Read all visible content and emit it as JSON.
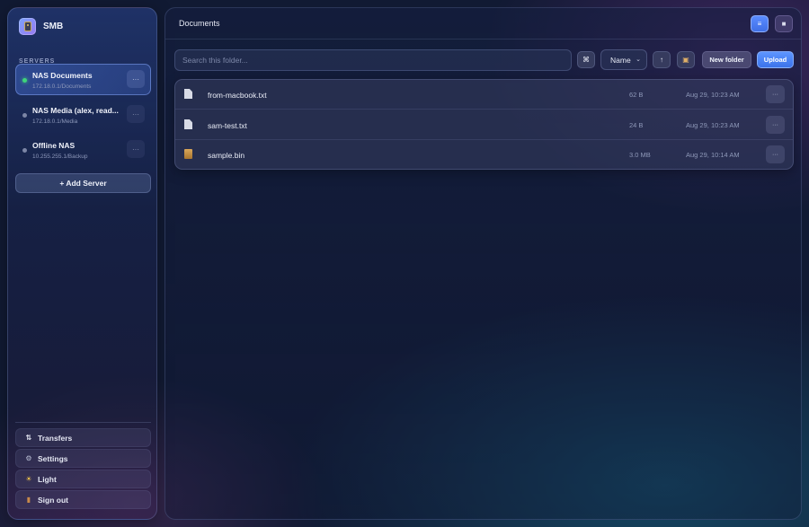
{
  "app": {
    "name": "SMB"
  },
  "sidebar": {
    "section_label": "SERVERS",
    "servers": [
      {
        "name": "NAS Documents",
        "path": "172.18.0.1/Documents",
        "status": "online",
        "more": "···"
      },
      {
        "name": "NAS Media (alex, read...",
        "path": "172.18.0.1/Media",
        "status": "idle",
        "more": "···"
      },
      {
        "name": "Offline NAS",
        "path": "10.255.255.1/Backup",
        "status": "offline",
        "more": "···"
      }
    ],
    "add_server_label": "+ Add Server",
    "footer": [
      {
        "icon": "transfer-icon",
        "glyph": "⇅",
        "label": "Transfers"
      },
      {
        "icon": "gear-icon",
        "glyph": "⚙",
        "label": "Settings"
      },
      {
        "icon": "sun-icon",
        "glyph": "☀",
        "label": "Light"
      },
      {
        "icon": "door-icon",
        "glyph": "▮",
        "label": "Sign out"
      }
    ]
  },
  "main": {
    "title": "Documents",
    "view_list_glyph": "≡",
    "view_grid_glyph": "■",
    "search_placeholder": "Search this folder...",
    "filter_glyph": "⌘",
    "sort_value": "Name",
    "sort_chevron": "⌄",
    "sort_dir_glyph": "↑",
    "archive_glyph": "▣",
    "new_folder_label": "New folder",
    "upload_label": "Upload",
    "files": [
      {
        "icon": "file-icon",
        "name": "from-macbook.txt",
        "size": "62 B",
        "date": "Aug 29, 10:23 AM",
        "more": "···"
      },
      {
        "icon": "file-icon",
        "name": "sam-test.txt",
        "size": "24 B",
        "date": "Aug 29, 10:23 AM",
        "more": "···"
      },
      {
        "icon": "package-icon",
        "name": "sample.bin",
        "size": "3.0 MB",
        "date": "Aug 29, 10:14 AM",
        "more": "···"
      }
    ]
  },
  "colors": {
    "accent": "#4a7ff5",
    "online": "#3fd57a",
    "background": "#111a33"
  }
}
